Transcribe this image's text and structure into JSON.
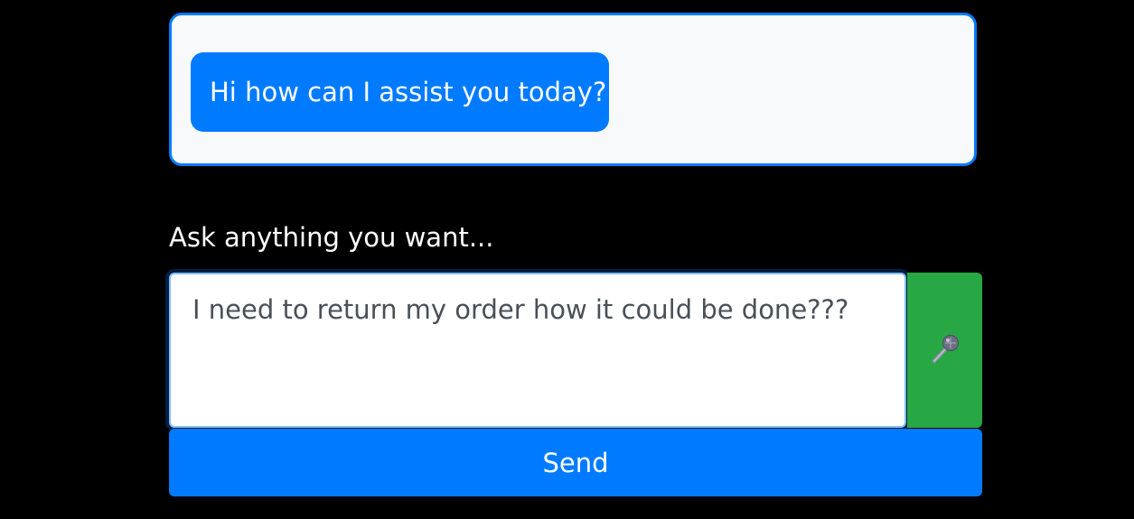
{
  "chat": {
    "messages": [
      {
        "sender": "bot",
        "text": "Hi how can I assist you today?"
      }
    ]
  },
  "form": {
    "label": "Ask anything you want...",
    "input_value": "I need to return my order how it could be done???",
    "mic_icon": "microphone-icon",
    "send_label": "Send"
  },
  "colors": {
    "primary": "#007bff",
    "success": "#28a745",
    "chat_bg": "#f8f9fa",
    "page_bg": "#000000"
  }
}
